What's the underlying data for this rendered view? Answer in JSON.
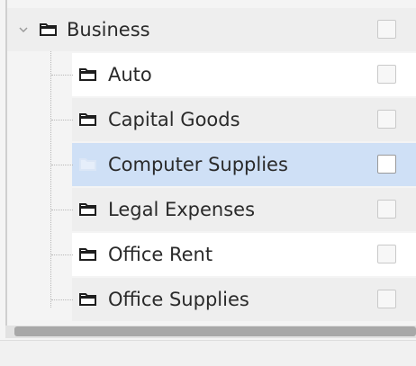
{
  "tree": {
    "parent": {
      "label": "Business",
      "expanded": true,
      "checked": false
    },
    "children": [
      {
        "label": "Auto",
        "checked": false,
        "selected": false
      },
      {
        "label": "Capital Goods",
        "checked": false,
        "selected": false
      },
      {
        "label": "Computer Supplies",
        "checked": false,
        "selected": true
      },
      {
        "label": "Legal Expenses",
        "checked": false,
        "selected": false
      },
      {
        "label": "Office Rent",
        "checked": false,
        "selected": false
      },
      {
        "label": "Office Supplies",
        "checked": false,
        "selected": false
      }
    ]
  },
  "colors": {
    "selection": "#cfe0f6",
    "row_alt": "#eeeeee",
    "text": "#2a2a2a"
  }
}
